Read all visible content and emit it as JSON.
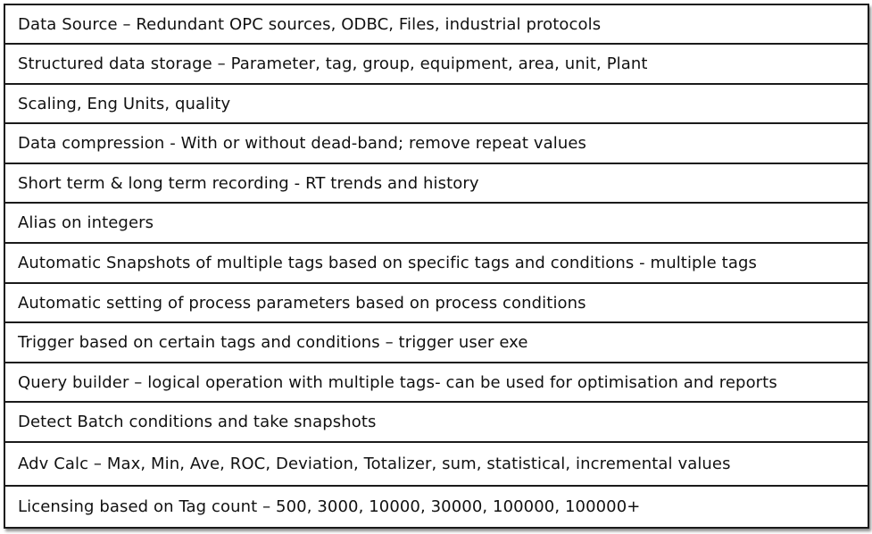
{
  "rows": [
    "Data Source – Redundant OPC sources, ODBC, Files, industrial protocols",
    "Structured data storage – Parameter, tag, group, equipment, area, unit, Plant",
    "Scaling, Eng Units, quality",
    "Data compression - With or without dead-band; remove repeat values",
    "Short term & long term recording -  RT trends and history",
    "Alias on integers",
    "Automatic Snapshots of multiple tags based on specific tags and conditions  - multiple tags",
    "Automatic setting of process parameters based on process conditions",
    "Trigger based on certain tags and conditions – trigger user exe",
    "Query builder – logical operation with multiple tags- can be used for optimisation and reports",
    "Detect Batch conditions and take snapshots",
    "Adv Calc – Max, Min, Ave, ROC, Deviation, Totalizer, sum, statistical, incremental values",
    "Licensing based on Tag count – 500, 3000, 10000, 30000, 100000, 100000+"
  ]
}
